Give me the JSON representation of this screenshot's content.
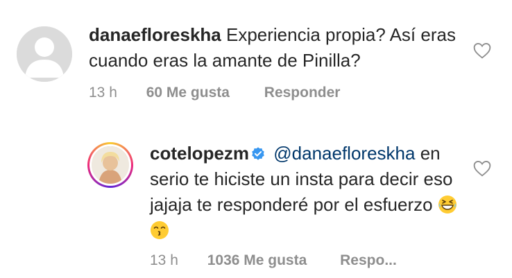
{
  "comment1": {
    "username": "danaefloreskha",
    "text": "Experiencia propia? Así eras cuando eras la amante de Pinilla?",
    "time": "13 h",
    "likes": "60 Me gusta",
    "reply": "Responder",
    "avatar": "default-user-avatar",
    "like_icon": "heart-outline-icon"
  },
  "comment2": {
    "username": "cotelopezm",
    "verified": true,
    "mention": "@danaefloreskha",
    "text": "en serio te hiciste un insta para decir eso jajaja te responderé por el esfuerzo",
    "emojis": [
      "grinning-squinting-face",
      "kissing-face-smiling-eyes"
    ],
    "time": "13 h",
    "likes": "1036 Me gusta",
    "reply": "Respo...",
    "avatar": "story-ring-avatar",
    "like_icon": "heart-outline-icon"
  },
  "colors": {
    "text": "#262626",
    "meta": "#8e8e8e",
    "mention": "#00376b",
    "verified": "#3897f0"
  }
}
